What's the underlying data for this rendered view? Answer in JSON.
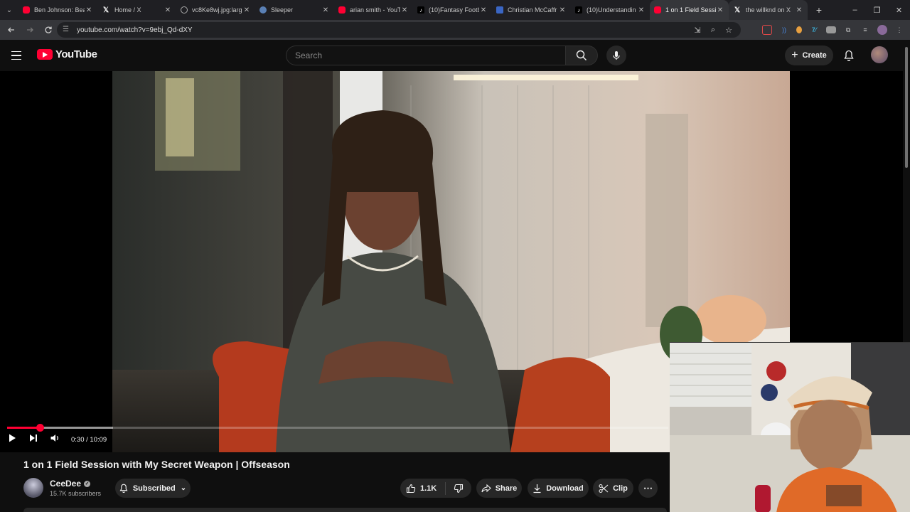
{
  "browser": {
    "tabs": [
      {
        "title": "Ben Johnson: Bea",
        "favicon": "youtube-icon"
      },
      {
        "title": "Home / X",
        "favicon": "x-icon"
      },
      {
        "title": "vc8Ke8wj.jpg:larg",
        "favicon": "globe-icon"
      },
      {
        "title": "Sleeper",
        "favicon": "sleeper-icon"
      },
      {
        "title": "arian smith - YouT",
        "favicon": "youtube-icon"
      },
      {
        "title": "(10)Fantasy Footb",
        "favicon": "tiktok-icon"
      },
      {
        "title": "Christian McCaffr",
        "favicon": "page-icon"
      },
      {
        "title": "(10)Understandin",
        "favicon": "tiktok-icon"
      },
      {
        "title": "1 on 1 Field Sessi",
        "favicon": "youtube-icon"
      },
      {
        "title": "the willknd on X",
        "favicon": "x-icon"
      }
    ],
    "active_tab_index": 8,
    "url": "youtube.com/watch?v=9ebj_Qd-dXY"
  },
  "youtube": {
    "logo_text": "YouTube",
    "search_placeholder": "Search",
    "create_label": "Create"
  },
  "player": {
    "time_display": "0:30 / 10:09",
    "played_fraction": 0.049,
    "buffered_fraction": 0.16
  },
  "video": {
    "title": "1 on 1 Field Session with My Secret Weapon | Offseason",
    "channel_name": "CeeDee",
    "subscribers": "15.7K subscribers",
    "subscribed_label": "Subscribed",
    "likes": "1.1K",
    "share_label": "Share",
    "download_label": "Download",
    "clip_label": "Clip"
  },
  "colors": {
    "accent": "#ff0033",
    "background": "#0f0f0f",
    "button_bg": "#272727"
  }
}
